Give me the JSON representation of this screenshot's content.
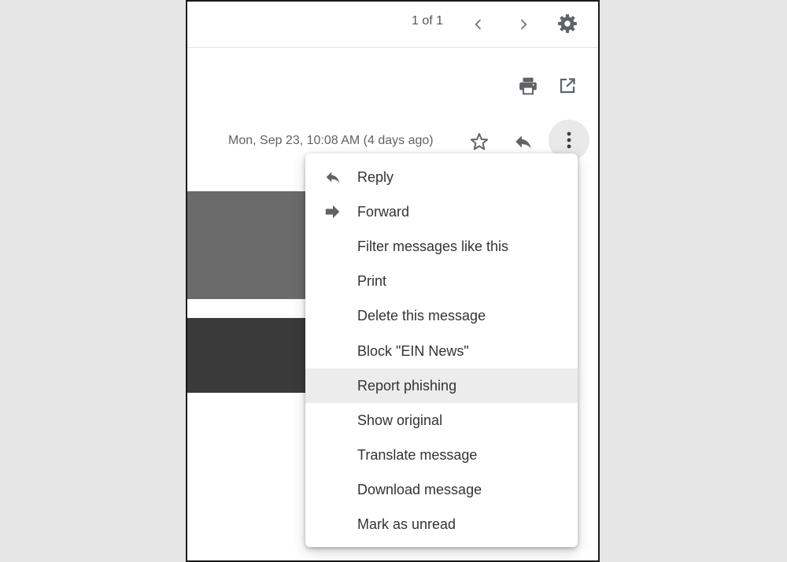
{
  "toolbar": {
    "pagination": "1 of 1",
    "icons": {
      "prev": "chevron-left-icon",
      "next": "chevron-right-icon",
      "settings": "gear-icon",
      "print": "print-icon",
      "open_new_window": "open-in-new-icon"
    }
  },
  "message": {
    "date": "Mon, Sep 23, 10:08 AM (4 days ago)",
    "icons": {
      "star": "star-icon",
      "reply": "reply-icon",
      "more": "more-vert-icon"
    }
  },
  "menu": {
    "items": [
      {
        "label": "Reply",
        "icon": "reply-icon"
      },
      {
        "label": "Forward",
        "icon": "forward-icon"
      },
      {
        "label": "Filter messages like this"
      },
      {
        "label": "Print"
      },
      {
        "label": "Delete this message"
      },
      {
        "label": "Block \"EIN News\""
      },
      {
        "label": "Report phishing",
        "highlighted": true
      },
      {
        "label": "Show original"
      },
      {
        "label": "Translate message"
      },
      {
        "label": "Download message"
      },
      {
        "label": "Mark as unread"
      }
    ]
  },
  "colors": {
    "icon": "#5f6368",
    "text": "#333333",
    "highlight": "#ececec",
    "frame": "#1a1a1a"
  }
}
